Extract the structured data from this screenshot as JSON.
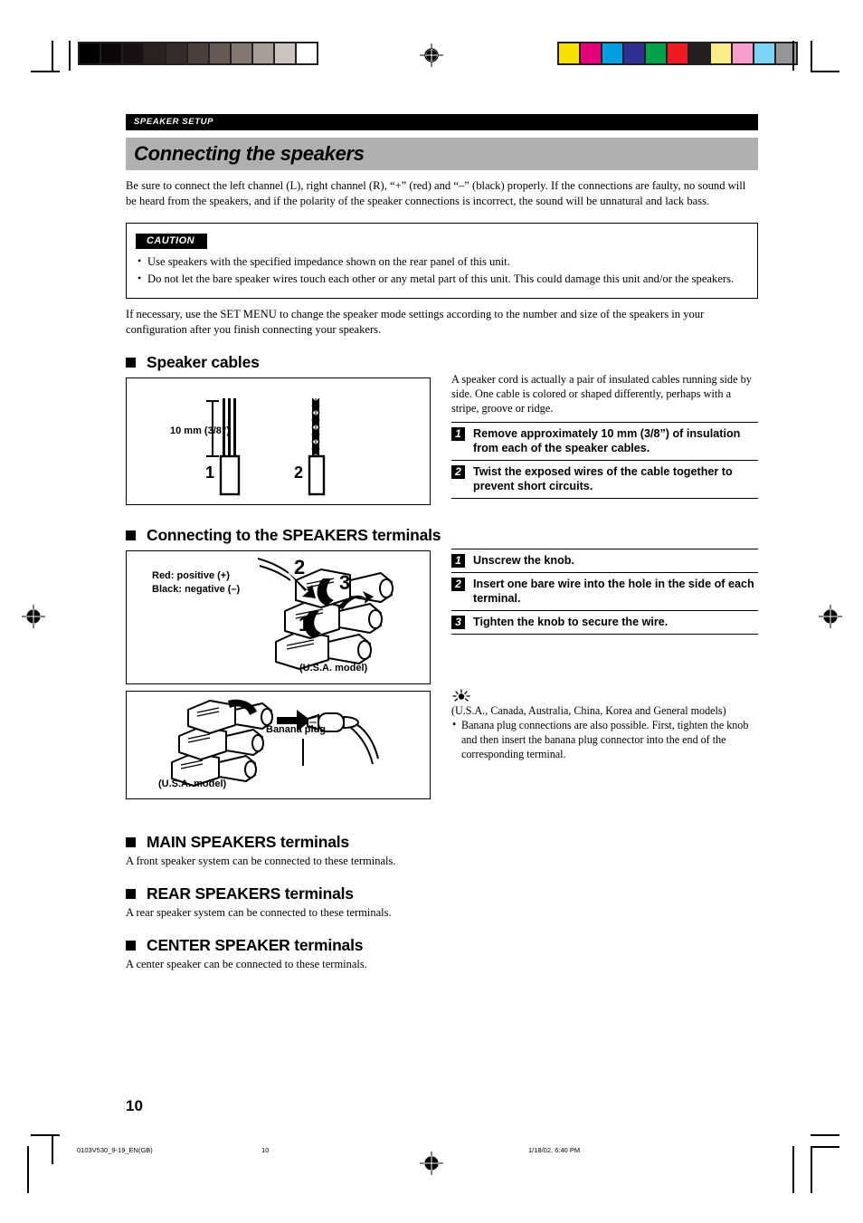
{
  "header": {
    "section_tab": "SPEAKER SETUP",
    "title": "Connecting the speakers"
  },
  "intro": "Be sure to connect the left channel (L), right channel (R), “+” (red) and “–” (black) properly. If the connections are faulty, no sound will be heard from the speakers, and if the polarity of the speaker connections is incorrect, the sound will be unnatural and lack bass.",
  "caution": {
    "label": "CAUTION",
    "items": [
      "Use speakers with the specified impedance shown on the rear panel of this unit.",
      "Do not let the bare speaker wires touch each other or any metal part of this unit. This could damage this unit and/or the speakers."
    ]
  },
  "after_caution": "If necessary, use the SET MENU to change the speaker mode settings according to the number and size of the speakers in your configuration after you finish connecting your speakers.",
  "speaker_cables": {
    "heading": "Speaker cables",
    "figure": {
      "measure_label": "10 mm (3/8”)",
      "callout_1": "1",
      "callout_2": "2"
    },
    "description": "A speaker cord is actually a pair of insulated cables running side by side. One cable is colored or shaped differently, perhaps with a stripe, groove or ridge.",
    "steps": [
      {
        "num": "1",
        "text": "Remove approximately 10 mm (3/8”) of insulation from each of the speaker cables."
      },
      {
        "num": "2",
        "text": "Twist the exposed wires of the cable together to prevent short circuits."
      }
    ]
  },
  "speakers_terminals": {
    "heading": "Connecting to the SPEAKERS terminals",
    "figure": {
      "legend_red": "Red: positive (+)",
      "legend_black": "Black: negative (–)",
      "callout_1": "1",
      "callout_2": "2",
      "callout_3": "3",
      "model_note": "(U.S.A. model)"
    },
    "steps": [
      {
        "num": "1",
        "text": "Unscrew the knob."
      },
      {
        "num": "2",
        "text": "Insert one bare wire into the hole in the side of each terminal."
      },
      {
        "num": "3",
        "text": "Tighten the knob to secure the wire."
      }
    ],
    "banana_figure": {
      "label": "Banana plug",
      "model_note": "(U.S.A. model)"
    },
    "tip": {
      "icon": "light-bulb-icon",
      "models": "(U.S.A., Canada, Australia, China, Korea and General models)",
      "note": "Banana plug connections are also possible. First, tighten the knob and then insert the banana plug connector into the end of the corresponding terminal."
    }
  },
  "terminal_sections": [
    {
      "heading": "MAIN SPEAKERS terminals",
      "body": "A front speaker system can be connected to these terminals."
    },
    {
      "heading": "REAR SPEAKERS terminals",
      "body": "A rear speaker system can be connected to these terminals."
    },
    {
      "heading": "CENTER SPEAKER terminals",
      "body": "A center speaker can be connected to these terminals."
    }
  ],
  "page_number": "10",
  "footer": {
    "file": "0103V530_9-19_EN(GB)",
    "page": "10",
    "timestamp": "1/18/02, 6:40 PM"
  },
  "print_marks": {
    "grayscale_bar": [
      "#000000",
      "#0d0808",
      "#191111",
      "#2b2220",
      "#352b28",
      "#4c403c",
      "#675954",
      "#857873",
      "#a89c97",
      "#cdc4c0",
      "#ffffff"
    ],
    "color_bar": [
      "#f5e000",
      "#e5007e",
      "#00a0e0",
      "#2e3192",
      "#00a14b",
      "#ed1c24",
      "#231f20",
      "#faee87",
      "#f59ecb",
      "#7ed4f5",
      "#939598"
    ]
  }
}
